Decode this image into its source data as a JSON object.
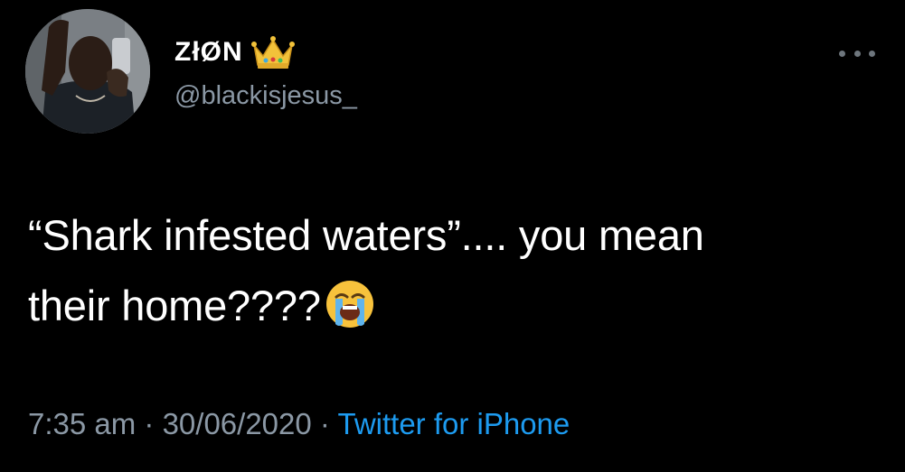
{
  "tweet": {
    "display_name": "ZłØN",
    "name_emoji": "crown-emoji",
    "handle": "@blackisjesus_",
    "text_line1": "“Shark infested waters”.... you mean",
    "text_line2": "their home????",
    "text_emoji": "loudly-crying-face-emoji",
    "time": "7:35 am",
    "separator1": " · ",
    "date": "30/06/2020",
    "separator2": " · ",
    "source": "Twitter for iPhone"
  },
  "colors": {
    "background": "#000000",
    "primary_text": "#ffffff",
    "secondary_text": "#8b98a5",
    "link": "#1d9bf0"
  }
}
